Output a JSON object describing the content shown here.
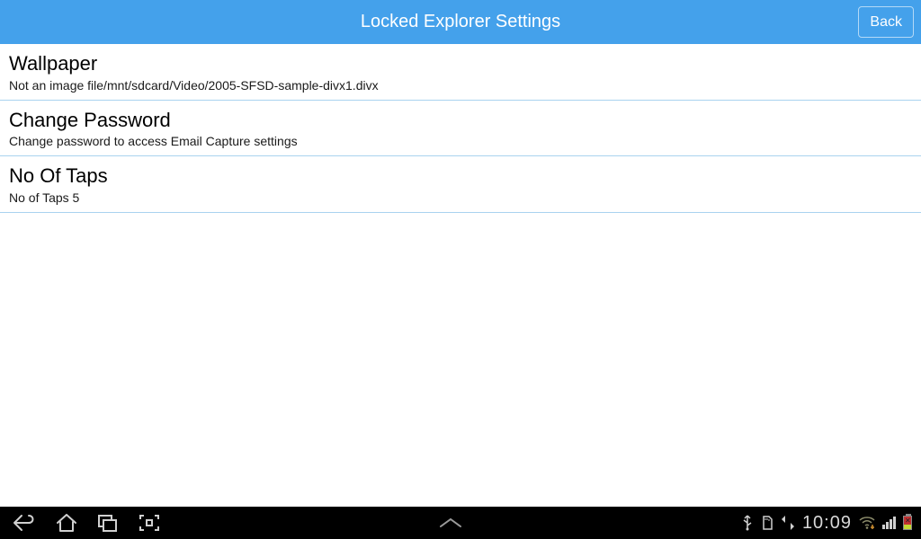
{
  "header": {
    "title": "Locked Explorer Settings",
    "back_label": "Back"
  },
  "settings": [
    {
      "title": "Wallpaper",
      "subtitle": "Not an image file/mnt/sdcard/Video/2005-SFSD-sample-divx1.divx"
    },
    {
      "title": "Change Password",
      "subtitle": "Change password to access Email Capture settings"
    },
    {
      "title": "No Of Taps",
      "subtitle": "No of Taps 5"
    }
  ],
  "statusbar": {
    "time": "10:09"
  }
}
